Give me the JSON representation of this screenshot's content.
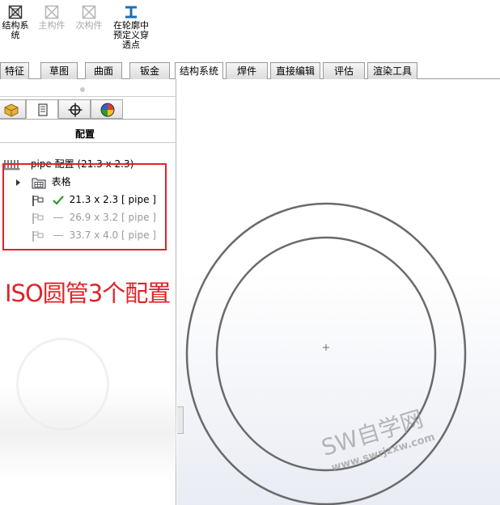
{
  "toolbar": {
    "items": [
      {
        "label": "结构系\n统",
        "icon": "structure-system-icon",
        "enabled": true
      },
      {
        "label": "主构件",
        "icon": "primary-member-icon",
        "enabled": false
      },
      {
        "label": "次构件",
        "icon": "secondary-member-icon",
        "enabled": false
      },
      {
        "label": "在轮廓中\n预定义穿\n透点",
        "icon": "profile-pierce-point-icon",
        "enabled": true
      }
    ]
  },
  "tabs": [
    "特征",
    "草图",
    "曲面",
    "钣金",
    "结构系统",
    "焊件",
    "直接编辑",
    "评估",
    "渲染工具"
  ],
  "active_tab": "结构系统",
  "panel": {
    "tab_icons": [
      "feature-manager-icon",
      "property-manager-icon",
      "configuration-manager-icon",
      "dim-xpert-icon",
      "display-manager-icon"
    ],
    "title": "配置",
    "root": "pipe 配置  (21.3 x 2.3)",
    "table_node": "表格",
    "configs": [
      {
        "label": "21.3 x 2.3 [ pipe ]",
        "active": true
      },
      {
        "label": "26.9 x 3.2 [ pipe ]",
        "active": false
      },
      {
        "label": "33.7 x 4.0 [ pipe ]",
        "active": false
      }
    ]
  },
  "annotation": "ISO圆管3个配置",
  "watermark": {
    "title": "SW自学网",
    "url": "www.swrjzxw.com",
    "left_logo": "SW"
  },
  "colors": {
    "annotation": "#e0232a",
    "checkmark": "#2f9a2f",
    "circle_stroke": "#6a6a6a"
  }
}
